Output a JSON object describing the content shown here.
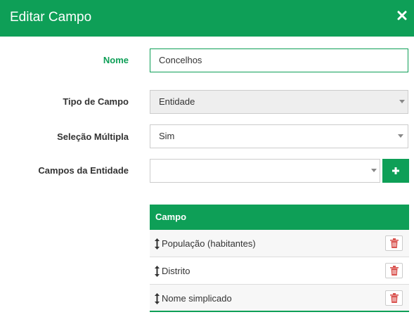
{
  "modal": {
    "title": "Editar Campo",
    "close_icon": "close-icon"
  },
  "form": {
    "nome": {
      "label": "Nome",
      "value": "Concelhos"
    },
    "tipo_de_campo": {
      "label": "Tipo de Campo",
      "value": "Entidade",
      "disabled": true
    },
    "selecao_multipla": {
      "label": "Seleção Múltipla",
      "value": "Sim"
    },
    "campos_da_entidade": {
      "label": "Campos da Entidade",
      "value": "",
      "add_icon": "plus-icon"
    }
  },
  "table": {
    "header": "Campo",
    "rows": [
      {
        "label": "População (habitantes)"
      },
      {
        "label": "Distrito"
      },
      {
        "label": "Nome simplicado"
      }
    ],
    "row_icons": {
      "drag": "vertical-resize-icon",
      "delete": "trash-icon"
    }
  },
  "colors": {
    "accent": "#0e9f57",
    "delete_icon": "#d9534f"
  }
}
